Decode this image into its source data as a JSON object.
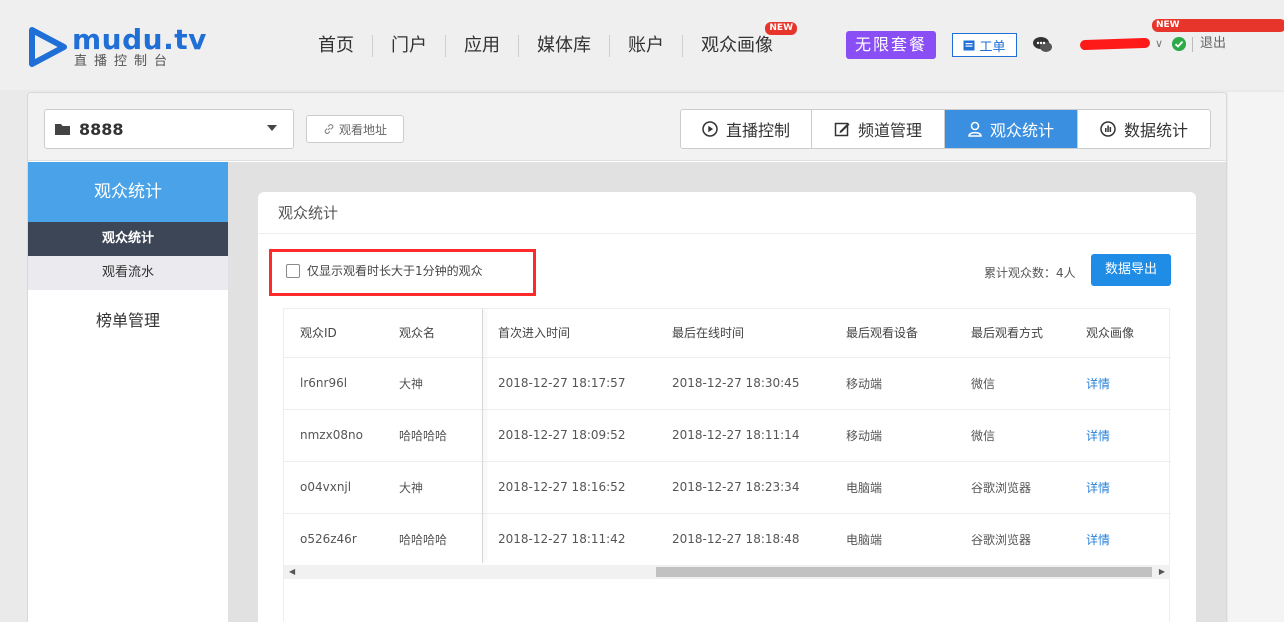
{
  "logo": {
    "text": "mudu.tv",
    "subtitle": "直播控制台"
  },
  "nav": [
    {
      "label": "首页"
    },
    {
      "label": "门户"
    },
    {
      "label": "应用"
    },
    {
      "label": "媒体库"
    },
    {
      "label": "账户"
    },
    {
      "label": "观众画像",
      "badge": "NEW"
    }
  ],
  "header": {
    "plan_label": "无限套餐",
    "ticket_label": "工单",
    "user_badge": "NEW",
    "logout_label": "退出"
  },
  "toolbar": {
    "channel_value": "8888",
    "watch_link_label": "观看地址",
    "tabs": [
      {
        "label": "直播控制",
        "icon": "play-circle-icon"
      },
      {
        "label": "频道管理",
        "icon": "edit-icon"
      },
      {
        "label": "观众统计",
        "icon": "user-icon",
        "active": true
      },
      {
        "label": "数据统计",
        "icon": "chart-icon"
      }
    ]
  },
  "sidebar": {
    "section1": "观众统计",
    "items": [
      {
        "label": "观众统计",
        "active": true
      },
      {
        "label": "观看流水"
      }
    ],
    "section2": "榜单管理"
  },
  "card": {
    "title": "观众统计",
    "filter_label": "仅显示观看时长大于1分钟的观众",
    "total_label": "累计观众数：4人",
    "export_label": "数据导出"
  },
  "table": {
    "headers": [
      "观众ID",
      "观众名",
      "首次进入时间",
      "最后在线时间",
      "最后观看设备",
      "最后观看方式",
      "观众画像"
    ],
    "rows": [
      [
        "lr6nr96l",
        "大神",
        "2018-12-27 18:17:57",
        "2018-12-27 18:30:45",
        "移动端",
        "微信",
        "详情"
      ],
      [
        "nmzx08no",
        "哈哈哈哈",
        "2018-12-27 18:09:52",
        "2018-12-27 18:11:14",
        "移动端",
        "微信",
        "详情"
      ],
      [
        "o04vxnjl",
        "大神",
        "2018-12-27 18:16:52",
        "2018-12-27 18:23:34",
        "电脑端",
        "谷歌浏览器",
        "详情"
      ],
      [
        "o526z46r",
        "哈哈哈哈",
        "2018-12-27 18:11:42",
        "2018-12-27 18:18:48",
        "电脑端",
        "谷歌浏览器",
        "详情"
      ]
    ]
  },
  "colors": {
    "brand": "#1f6fd6",
    "tab_active": "#3b8fe0",
    "plan": "#8a4ef5",
    "export": "#1f8ce6",
    "highlight": "#ff2a2a"
  }
}
